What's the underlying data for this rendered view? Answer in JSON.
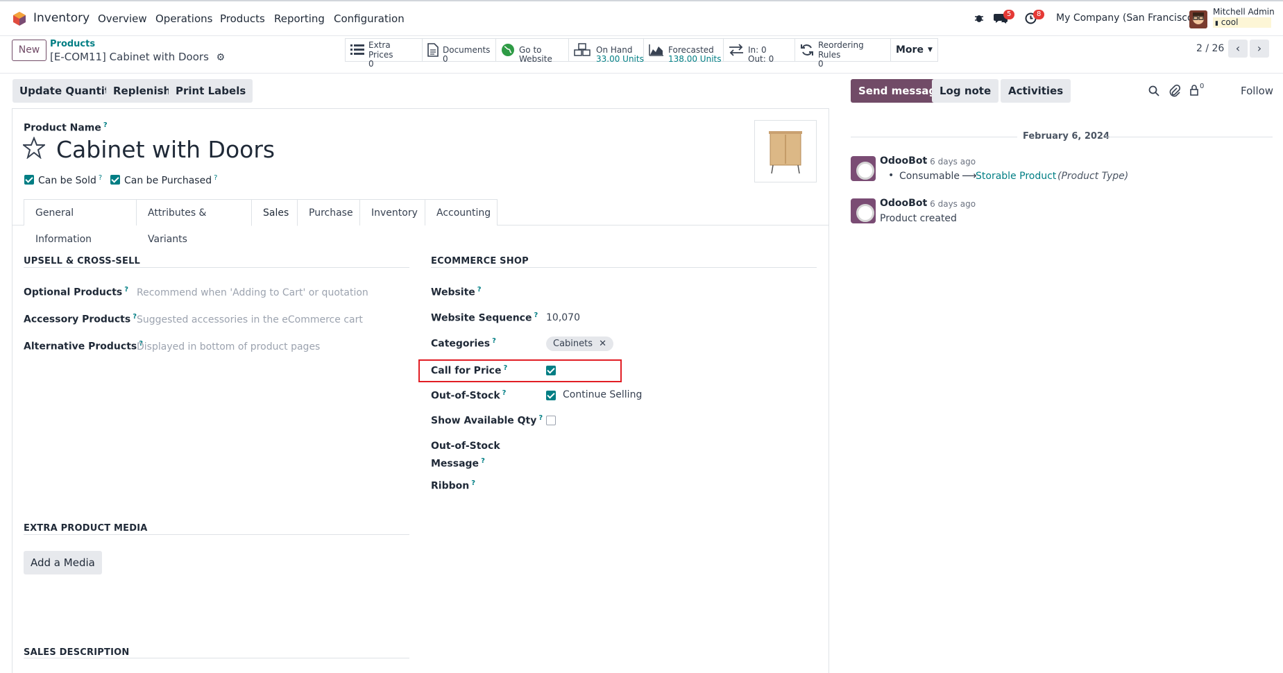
{
  "topnav": {
    "app_name": "Inventory",
    "menu": [
      "Overview",
      "Operations",
      "Products",
      "Reporting",
      "Configuration"
    ],
    "chat_badge": "5",
    "activity_badge": "8",
    "company": "My Company (San Francisco)",
    "user_name": "Mitchell Admin",
    "db_name": "cool"
  },
  "control": {
    "new_label": "New",
    "breadcrumb_parent": "Products",
    "breadcrumb_current": "[E-COM11] Cabinet with Doors",
    "pager": "2 / 26",
    "more_label": "More"
  },
  "smart_buttons": [
    {
      "label": "Extra Prices",
      "value": "0",
      "icon": "list-icon"
    },
    {
      "label": "Documents",
      "value": "0",
      "icon": "document-icon"
    },
    {
      "label": "Go to",
      "value": "Website",
      "icon": "globe-icon"
    },
    {
      "label": "On Hand",
      "value": "33.00 Units",
      "icon": "cubes-icon"
    },
    {
      "label": "Forecasted",
      "value": "138.00 Units",
      "icon": "area-chart-icon"
    },
    {
      "label": "In: 0",
      "value": "Out: 0",
      "icon": "exchange-icon"
    },
    {
      "label": "Reordering Rules",
      "value": "0",
      "icon": "refresh-icon"
    }
  ],
  "actions": {
    "update_quantity": "Update Quantity",
    "replenish": "Replenish",
    "print_labels": "Print Labels"
  },
  "product": {
    "name_label": "Product Name",
    "name": "Cabinet with Doors",
    "can_be_sold": "Can be Sold",
    "can_be_purchased": "Can be Purchased"
  },
  "tabs": [
    "General Information",
    "Attributes & Variants",
    "Sales",
    "Purchase",
    "Inventory",
    "Accounting"
  ],
  "upsell": {
    "title": "UPSELL & CROSS-SELL",
    "optional_label": "Optional Products",
    "optional_ph": "Recommend when 'Adding to Cart' or quotation",
    "accessory_label": "Accessory Products",
    "accessory_ph": "Suggested accessories in the eCommerce cart",
    "alternative_label": "Alternative Products",
    "alternative_ph": "Displayed in bottom of product pages"
  },
  "ecommerce": {
    "title": "ECOMMERCE SHOP",
    "website_label": "Website",
    "sequence_label": "Website Sequence",
    "sequence_value": "10,070",
    "categories_label": "Categories",
    "category_tag": "Cabinets",
    "call_for_price_label": "Call for Price",
    "out_of_stock_label": "Out-of-Stock",
    "continue_selling": "Continue Selling",
    "show_qty_label": "Show Available Qty",
    "oos_message_label_1": "Out-of-Stock",
    "oos_message_label_2": "Message",
    "ribbon_label": "Ribbon"
  },
  "media": {
    "title": "EXTRA PRODUCT MEDIA",
    "add_media": "Add a Media"
  },
  "sales_description": {
    "title": "SALES DESCRIPTION"
  },
  "chatter": {
    "send_message": "Send message",
    "log_note": "Log note",
    "activities": "Activities",
    "follower_count": "0",
    "follow": "Follow",
    "date": "February 6, 2024",
    "messages": [
      {
        "author": "OdooBot",
        "time": "- 6 days ago",
        "old": "Consumable",
        "new": "Storable Product",
        "field": "(Product Type)"
      },
      {
        "author": "OdooBot",
        "time": "- 6 days ago",
        "body": "Product created"
      }
    ]
  },
  "colors": {
    "primary": "#714b67",
    "link": "#017e84",
    "highlight": "#e11d24"
  }
}
